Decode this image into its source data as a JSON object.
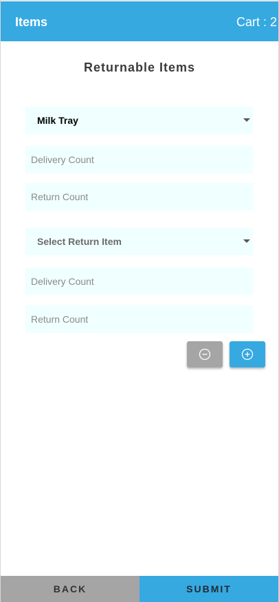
{
  "app_bar": {
    "title": "Items",
    "cart_label": "Cart : 2"
  },
  "section": {
    "title": "Returnable Items"
  },
  "groups": [
    {
      "item_select": {
        "value": "Milk Tray"
      },
      "delivery_count": {
        "placeholder": "Delivery Count"
      },
      "return_count": {
        "placeholder": "Return Count"
      }
    },
    {
      "item_select": {
        "value": "Select Return Item"
      },
      "delivery_count": {
        "placeholder": "Delivery Count"
      },
      "return_count": {
        "placeholder": "Return Count"
      }
    }
  ],
  "icons": {
    "remove": "minus-circle-icon",
    "add": "plus-circle-icon",
    "dropdown": "caret-down-icon"
  },
  "footer": {
    "back_label": "BACK",
    "submit_label": "SUBMIT"
  },
  "colors": {
    "primary": "#36a9e1",
    "secondary": "#a5a5a5",
    "field_bg": "#f0ffff"
  }
}
